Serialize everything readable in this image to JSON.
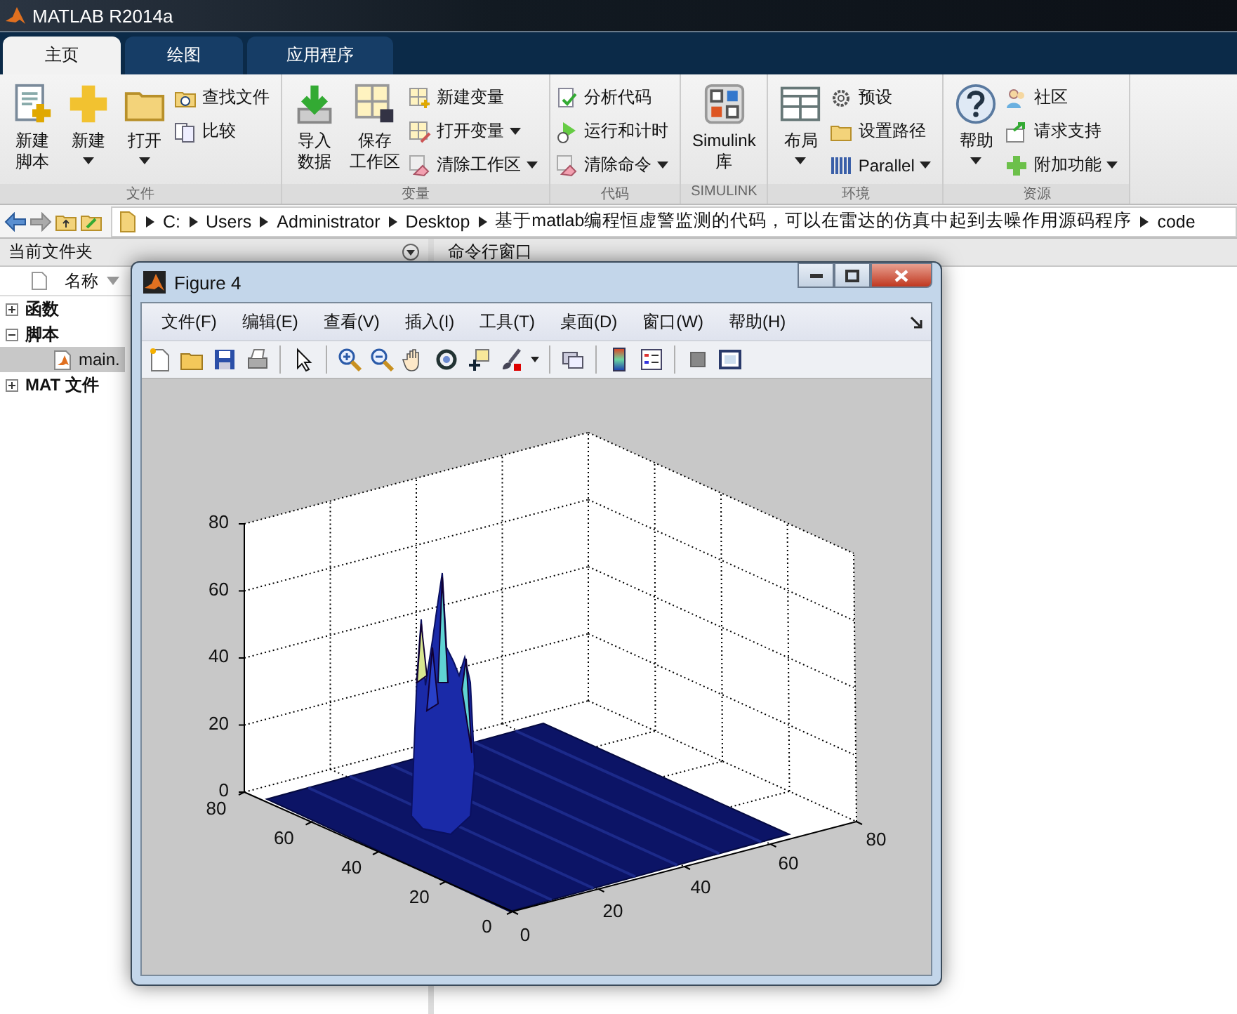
{
  "window": {
    "title": "MATLAB R2014a"
  },
  "tabs": [
    {
      "label": "主页",
      "selected": true
    },
    {
      "label": "绘图",
      "selected": false
    },
    {
      "label": "应用程序",
      "selected": false
    }
  ],
  "ribbon": {
    "groups": [
      {
        "label": "文件",
        "items": [
          {
            "kind": "large",
            "lines": [
              "新建",
              "脚本"
            ],
            "dropdown": false
          },
          {
            "kind": "large",
            "lines": [
              "新建"
            ],
            "dropdown": true
          },
          {
            "kind": "large",
            "lines": [
              "打开"
            ],
            "dropdown": true
          },
          {
            "kind": "stack",
            "items": [
              {
                "label": "查找文件",
                "dropdown": false
              },
              {
                "label": "比较",
                "dropdown": false
              }
            ]
          }
        ]
      },
      {
        "label": "变量",
        "items": [
          {
            "kind": "large",
            "lines": [
              "导入",
              "数据"
            ],
            "dropdown": false
          },
          {
            "kind": "large",
            "lines": [
              "保存",
              "工作区"
            ],
            "dropdown": false
          },
          {
            "kind": "stack",
            "items": [
              {
                "label": "新建变量",
                "dropdown": false
              },
              {
                "label": "打开变量",
                "dropdown": true
              },
              {
                "label": "清除工作区",
                "dropdown": true
              }
            ]
          }
        ]
      },
      {
        "label": "代码",
        "items": [
          {
            "kind": "stack",
            "items": [
              {
                "label": "分析代码",
                "dropdown": false
              },
              {
                "label": "运行和计时",
                "dropdown": false
              },
              {
                "label": "清除命令",
                "dropdown": true
              }
            ]
          }
        ]
      },
      {
        "label": "SIMULINK",
        "items": [
          {
            "kind": "large",
            "lines": [
              "Simulink",
              "库"
            ],
            "dropdown": false
          }
        ]
      },
      {
        "label": "环境",
        "items": [
          {
            "kind": "large",
            "lines": [
              "布局"
            ],
            "dropdown": true
          },
          {
            "kind": "stack",
            "items": [
              {
                "label": "预设",
                "dropdown": false
              },
              {
                "label": "设置路径",
                "dropdown": false
              },
              {
                "label": "Parallel",
                "dropdown": true
              }
            ]
          }
        ]
      },
      {
        "label": "资源",
        "items": [
          {
            "kind": "large",
            "lines": [
              "帮助"
            ],
            "dropdown": true
          },
          {
            "kind": "stack",
            "items": [
              {
                "label": "社区",
                "dropdown": false
              },
              {
                "label": "请求支持",
                "dropdown": false
              },
              {
                "label": "附加功能",
                "dropdown": true
              }
            ]
          }
        ]
      }
    ]
  },
  "address_bar": {
    "segments": [
      "C:",
      "Users",
      "Administrator",
      "Desktop",
      "基于matlab编程恒虚警监测的代码，可以在雷达的仿真中起到去噪作用源码程序",
      "code"
    ]
  },
  "current_folder": {
    "title": "当前文件夹",
    "column": "名称",
    "tree": [
      {
        "label": "函数",
        "kind": "folder",
        "expanded": false
      },
      {
        "label": "脚本",
        "kind": "folder",
        "expanded": true,
        "children": [
          {
            "label": "main.",
            "kind": "file",
            "selected": true
          }
        ]
      },
      {
        "label": "MAT 文件",
        "kind": "folder",
        "expanded": false
      }
    ]
  },
  "command_window": {
    "title": "命令行窗口"
  },
  "figure": {
    "title": "Figure 4",
    "menu": [
      "文件(F)",
      "编辑(E)",
      "查看(V)",
      "插入(I)",
      "工具(T)",
      "桌面(D)",
      "窗口(W)",
      "帮助(H)"
    ],
    "plot": {
      "z_ticks": [
        "80",
        "60",
        "40",
        "20",
        "0"
      ],
      "y_ticks": [
        "80",
        "60",
        "40",
        "20",
        "0"
      ],
      "x_ticks": [
        "0",
        "20",
        "40",
        "60",
        "80"
      ]
    }
  }
}
